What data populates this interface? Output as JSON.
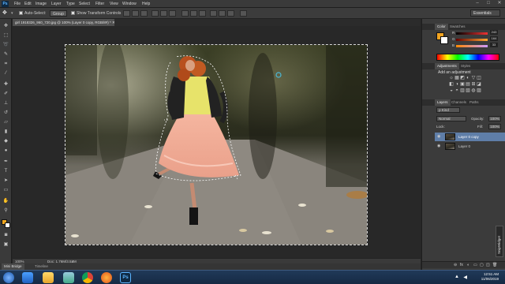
{
  "app": {
    "logo": "Ps"
  },
  "menu": {
    "items": [
      "File",
      "Edit",
      "Image",
      "Layer",
      "Type",
      "Select",
      "Filter",
      "View",
      "Window",
      "Help"
    ]
  },
  "window_controls": {
    "minimize": "–",
    "maximize": "□",
    "close": "✕"
  },
  "options_bar": {
    "auto_select_label": "Auto-Select:",
    "auto_select_value": "Group",
    "show_transform_label": "Show Transform Controls",
    "workspace": "Essentials"
  },
  "document": {
    "tab_title": "girl 1918326_960_720.jpg @ 100% (Layer 0 copy, RGB/8#) * ✕",
    "zoom": "100%",
    "doc_size": "Doc: 1.76M/3.53M"
  },
  "mini_bridge": {
    "tabs": [
      "Mini Bridge",
      "Timeline"
    ]
  },
  "panels": {
    "color": {
      "tabs": [
        "Color",
        "Swatches"
      ],
      "sliders": [
        {
          "label": "R",
          "value": "243",
          "color": "#e33"
        },
        {
          "label": "G",
          "value": "164",
          "color": "#3c3"
        },
        {
          "label": "B",
          "value": "33",
          "color": "#37f"
        }
      ],
      "fg_color": "#f3a421"
    },
    "adjustments": {
      "tabs": [
        "Adjustments",
        "Styles"
      ],
      "title": "Add an adjustment",
      "icons_row1": [
        "☼",
        "▦",
        "◩",
        "◐",
        "▽",
        "◫"
      ],
      "icons_row2": [
        "◧",
        "◑",
        "▣",
        "▤",
        "⊞",
        "◪"
      ],
      "icons_row3": [
        "◒",
        "◓",
        "▥",
        "▧",
        "◍",
        "▨"
      ]
    },
    "layers": {
      "tabs": [
        "Layers",
        "Channels",
        "Paths"
      ],
      "kind_label": "ρ Kind",
      "blend_mode": "Normal",
      "opacity_label": "Opacity:",
      "opacity_value": "100%",
      "lock_label": "Lock:",
      "fill_label": "Fill:",
      "fill_value": "100%",
      "rows": [
        {
          "name": "Layer 0 copy",
          "selected": true
        },
        {
          "name": "Layer 0",
          "selected": false
        }
      ],
      "bottom_icons": [
        "⊖",
        "fx",
        "◐",
        "▭",
        "▢",
        "◫",
        "🗑"
      ]
    }
  },
  "side_widget": {
    "label": "SnipWidget"
  },
  "taskbar": {
    "time": "12:51 AM",
    "date": "11/06/2019"
  }
}
